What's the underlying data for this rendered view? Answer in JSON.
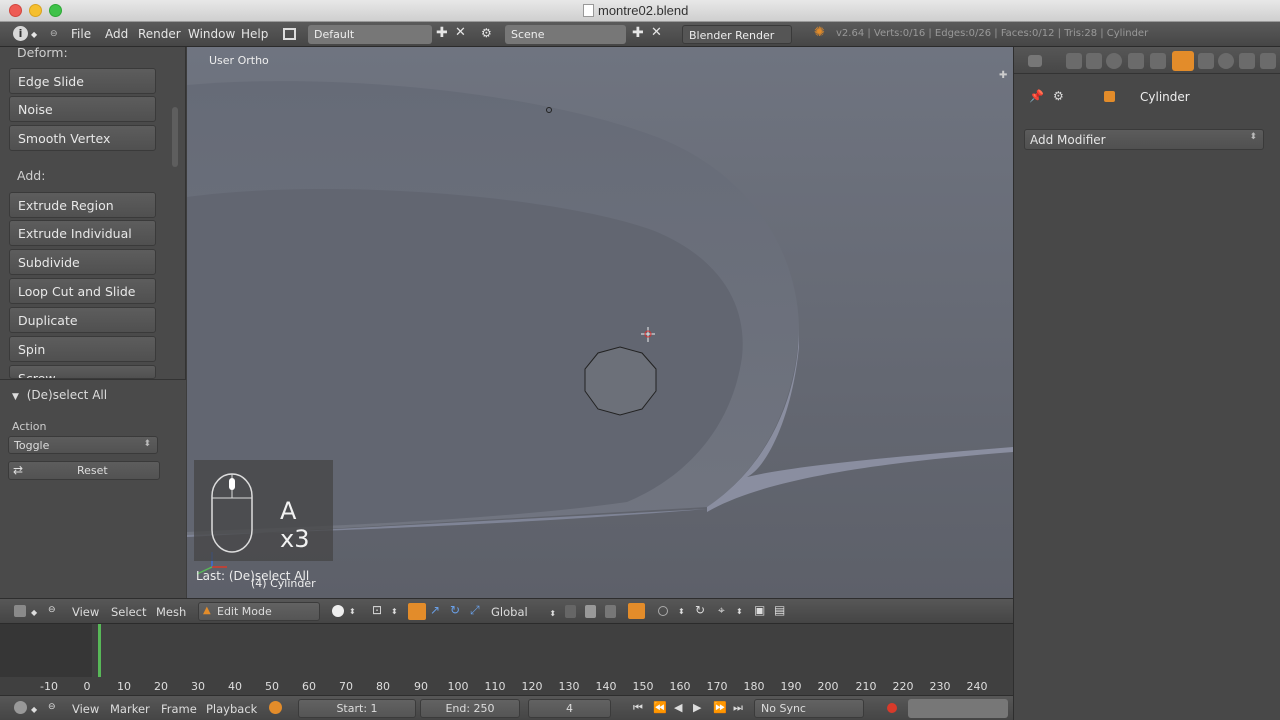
{
  "window": {
    "title": "montre02.blend"
  },
  "infobar": {
    "menus": [
      "File",
      "Add",
      "Render",
      "Window",
      "Help"
    ],
    "screen_layout": "Default",
    "scene": "Scene",
    "render_engine": "Blender Render",
    "stats": "v2.64 | Verts:0/16 | Edges:0/26 | Faces:0/12 | Tris:28 | Cylinder"
  },
  "toolshelf": {
    "deform_label": "Deform:",
    "deform_items": [
      "Edge Slide",
      "Noise",
      "Smooth Vertex"
    ],
    "add_label": "Add:",
    "add_items": [
      "Extrude Region",
      "Extrude Individual",
      "Subdivide",
      "Loop Cut and Slide",
      "Duplicate",
      "Spin",
      "Screw"
    ]
  },
  "operator_panel": {
    "title": "(De)select All",
    "action_label": "Action",
    "action_value": "Toggle",
    "reset_label": "Reset"
  },
  "viewport": {
    "view_label": "User Ortho",
    "key_hint": "A x3",
    "last_operator": "Last: (De)select All",
    "object_label": "(4) Cylinder"
  },
  "viewport_header": {
    "menus": [
      "View",
      "Select",
      "Mesh"
    ],
    "mode": "Edit Mode",
    "orientation": "Global"
  },
  "timeline": {
    "ticks": [
      "-10",
      "0",
      "10",
      "20",
      "30",
      "40",
      "50",
      "60",
      "70",
      "80",
      "90",
      "100",
      "110",
      "120",
      "130",
      "140",
      "150",
      "160",
      "170",
      "180",
      "190",
      "200",
      "210",
      "220",
      "230",
      "240"
    ],
    "current_frame": "4",
    "start": "Start: 1",
    "end": "End: 250",
    "sync": "No Sync"
  },
  "timeline_header": {
    "menus": [
      "View",
      "Marker",
      "Frame",
      "Playback"
    ]
  },
  "properties": {
    "context_object": "Cylinder",
    "add_modifier": "Add Modifier"
  },
  "colors": {
    "frame_cursor": "#58b858",
    "record": "#d83a2a",
    "active_tool": "#e38c2a"
  }
}
